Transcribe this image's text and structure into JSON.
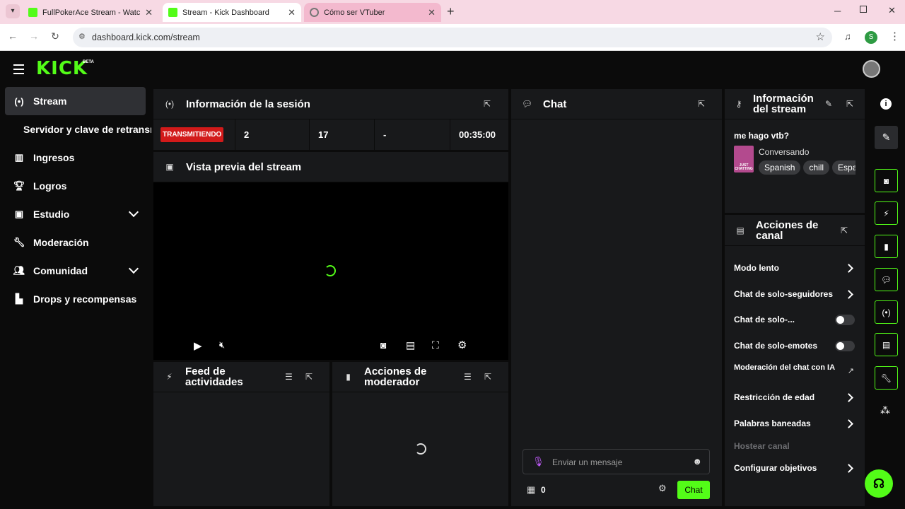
{
  "browser": {
    "tabs": [
      {
        "title": "FullPokerAce Stream - Watch Live on Kick",
        "active": false
      },
      {
        "title": "Stream - Kick Dashboard",
        "active": true
      },
      {
        "title": "Cómo ser VTuber",
        "active": false
      }
    ],
    "url": "dashboard.kick.com/stream",
    "profile_initial": "S"
  },
  "brand": {
    "logo": "KICK",
    "beta": "BETA",
    "accent": "#53fc18",
    "live_red": "#d21a1a"
  },
  "sidebar": {
    "items": [
      {
        "label": "Stream",
        "icon": "broadcast-icon",
        "active": true
      },
      {
        "label": "Servidor y clave de retransmisión",
        "sub": true
      },
      {
        "label": "Ingresos",
        "icon": "chart-icon"
      },
      {
        "label": "Logros",
        "icon": "trophy-icon"
      },
      {
        "label": "Estudio",
        "icon": "studio-icon",
        "expandable": true
      },
      {
        "label": "Moderación",
        "icon": "wrench-icon"
      },
      {
        "label": "Comunidad",
        "icon": "users-icon",
        "expandable": true
      },
      {
        "label": "Drops y recompensas",
        "icon": "gift-icon"
      }
    ]
  },
  "session": {
    "title": "Información de la sesión",
    "status": "TRANSMITIENDO",
    "stats": [
      "2",
      "17",
      "-",
      "00:35:00"
    ]
  },
  "preview": {
    "title": "Vista previa del stream"
  },
  "feed": {
    "title_line1": "Feed de",
    "title_line2": "actividades"
  },
  "modactions": {
    "title_line1": "Acciones de",
    "title_line2": "moderador"
  },
  "chat": {
    "title": "Chat",
    "placeholder": "Enviar un mensaje",
    "count": "0",
    "send_label": "Chat"
  },
  "stream_info": {
    "title_line1": "Información",
    "title_line2": "del stream",
    "stream_title": "me hago vtb?",
    "category": "Conversando",
    "thumb_text": "JUST CHATTING",
    "tags": [
      "Spanish",
      "chill",
      "Español"
    ]
  },
  "channel_actions": {
    "title_line1": "Acciones de",
    "title_line2": "canal",
    "items": [
      {
        "label": "Modo lento",
        "control": "chevron"
      },
      {
        "label": "Chat de solo-seguidores",
        "control": "chevron"
      },
      {
        "label": "Chat de solo-...",
        "control": "toggle"
      },
      {
        "label": "Chat de solo-emotes",
        "control": "toggle"
      },
      {
        "label": "Moderación del chat con IA",
        "control": "external"
      },
      {
        "label": "Restricción de edad",
        "control": "chevron"
      },
      {
        "label": "Palabras baneadas",
        "control": "chevron"
      },
      {
        "label": "Hostear canal",
        "control": "none",
        "disabled": true
      },
      {
        "label": "Configurar objetivos",
        "control": "chevron"
      }
    ]
  }
}
